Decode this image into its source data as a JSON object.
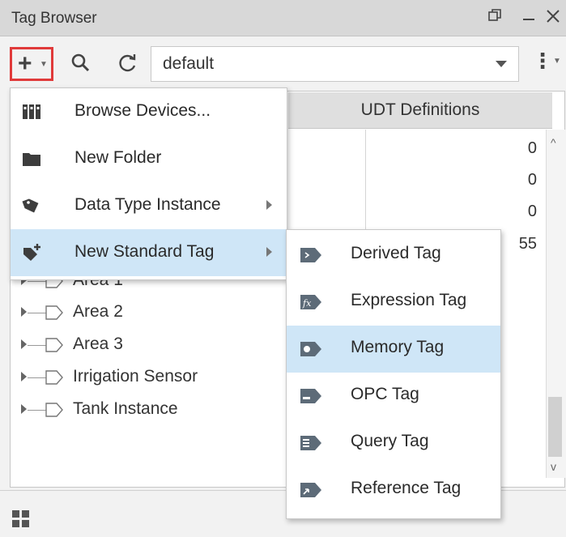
{
  "window": {
    "title": "Tag Browser",
    "controls": [
      "restore-icon",
      "minimize-icon",
      "close-icon"
    ]
  },
  "toolbar": {
    "add_icon": "plus-icon",
    "search_icon": "search-icon",
    "refresh_icon": "refresh-icon",
    "provider_value": "default",
    "more_icon": "kebab-menu-icon"
  },
  "tabs": {
    "udt": "UDT Definitions"
  },
  "udt_counts": [
    "0",
    "0",
    "0",
    "55"
  ],
  "tree": {
    "items": [
      {
        "label": "Area 1"
      },
      {
        "label": "Area 2"
      },
      {
        "label": "Area 3"
      },
      {
        "label": "Irrigation Sensor"
      },
      {
        "label": "Tank Instance"
      }
    ]
  },
  "menu": {
    "items": [
      {
        "label": "Browse Devices...",
        "icon": "devices-icon"
      },
      {
        "label": "New Folder",
        "icon": "folder-icon"
      },
      {
        "label": "Data Type Instance",
        "icon": "tag-label-icon"
      },
      {
        "label": "New Standard Tag",
        "icon": "tag-add-icon"
      }
    ]
  },
  "submenu": {
    "items": [
      {
        "label": "Derived Tag",
        "icon": "derived-tag-icon"
      },
      {
        "label": "Expression Tag",
        "icon": "expression-tag-icon"
      },
      {
        "label": "Memory Tag",
        "icon": "memory-tag-icon"
      },
      {
        "label": "OPC Tag",
        "icon": "opc-tag-icon"
      },
      {
        "label": "Query Tag",
        "icon": "query-tag-icon"
      },
      {
        "label": "Reference Tag",
        "icon": "reference-tag-icon"
      }
    ]
  },
  "colors": {
    "highlight": "#cfe6f7",
    "add_button_border": "#e03a3a"
  }
}
